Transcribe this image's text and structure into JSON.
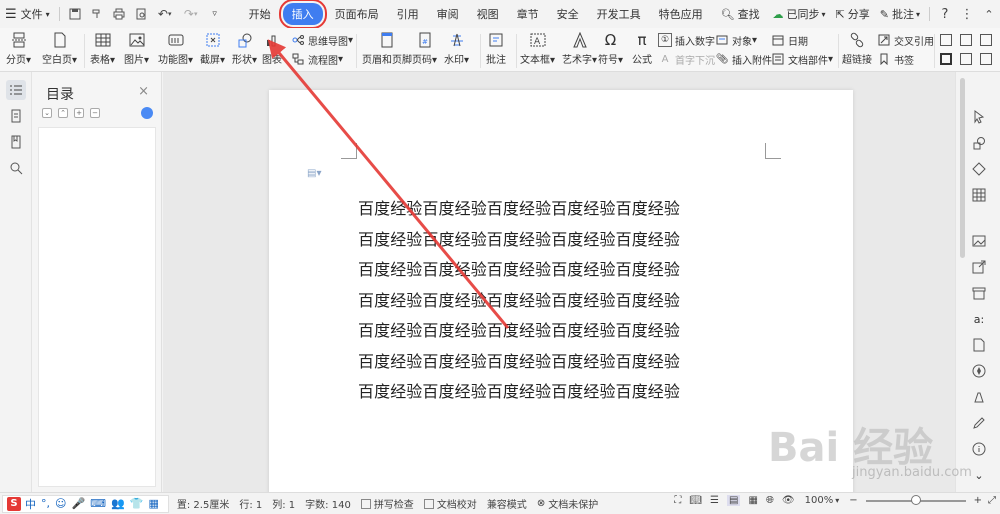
{
  "menubar": {
    "file_label": "文件",
    "tabs": [
      "开始",
      "插入",
      "页面布局",
      "引用",
      "审阅",
      "视图",
      "章节",
      "安全",
      "开发工具",
      "特色应用"
    ],
    "active_tab": "插入",
    "search_label": "查找",
    "sync_label": "已同步",
    "share_label": "分享",
    "comment_label": "批注"
  },
  "ribbon": {
    "buttons": {
      "page_break": "分页",
      "blank_page": "空白页",
      "table": "表格",
      "picture": "图片",
      "function_chart": "功能图",
      "screenshot": "截屏",
      "shape": "形状",
      "chart": "图表",
      "mindmap": "思维导图",
      "flowchart": "流程图",
      "header_footer": "页眉和页脚",
      "page_number": "页码",
      "watermark": "水印",
      "comment": "批注",
      "textbox": "文本框",
      "wordart": "艺术字",
      "symbol": "符号",
      "formula": "公式",
      "insert_number": "插入数字",
      "drop_cap": "首字下沉",
      "object": "对象",
      "attachment": "插入附件",
      "date": "日期",
      "doc_parts": "文档部件",
      "hyperlink": "超链接",
      "cross_ref": "交叉引用",
      "bookmark": "书签"
    }
  },
  "toc": {
    "title": "目录"
  },
  "document": {
    "lines": [
      "百度经验百度经验百度经验百度经验百度经验",
      "百度经验百度经验百度经验百度经验百度经验",
      "百度经验百度经验百度经验百度经验百度经验",
      "百度经验百度经验百度经验百度经验百度经验",
      "百度经验百度经验百度经验百度经验百度经验",
      "百度经验百度经验百度经验百度经验百度经验",
      "百度经验百度经验百度经验百度经验百度经验"
    ]
  },
  "statusbar": {
    "ime": [
      "中",
      "°,",
      "☺",
      "🎤",
      "⌨",
      "👥",
      "👕",
      "▦"
    ],
    "position": "置: 2.5厘米",
    "row": "行: 1",
    "column": "列: 1",
    "word_count": "字数: 140",
    "spell_check": "拼写检查",
    "doc_compare": "文档校对",
    "compat_mode": "兼容模式",
    "protection": "文档未保护",
    "zoom": "100%",
    "zoom_level": 1.0
  },
  "watermark": {
    "main": "Bai  经验",
    "sub": "jingyan.baidu.com"
  },
  "colors": {
    "accent": "#3f7df0",
    "highlight": "#e53935"
  }
}
